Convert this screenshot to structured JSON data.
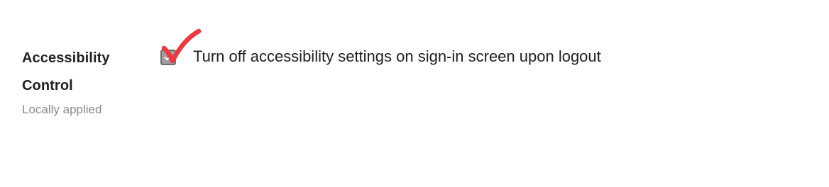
{
  "setting": {
    "title_line1": "Accessibility",
    "title_line2": "Control",
    "scope": "Locally applied",
    "checkbox_label": "Turn off accessibility settings on sign-in screen upon logout",
    "checked": true
  },
  "icons": {
    "checkbox": "checkbox-checked-icon",
    "annotation": "red-checkmark-icon"
  },
  "colors": {
    "annotation_red": "#f0373f",
    "checkbox_fill": "#9e9e9e",
    "title_text": "#212121",
    "subtitle_text": "#8a8a8a"
  }
}
